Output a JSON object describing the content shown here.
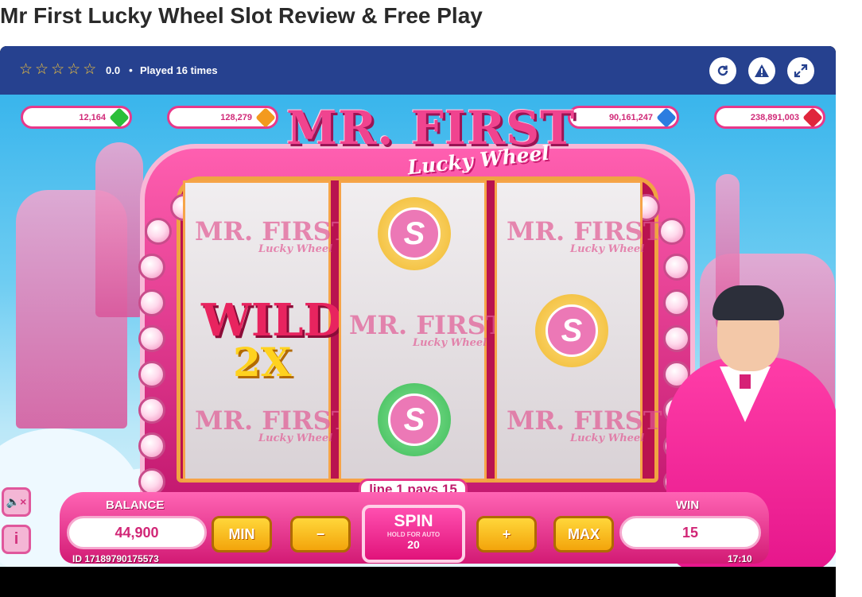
{
  "page": {
    "title": "Mr First Lucky Wheel Slot Review & Free Play"
  },
  "topbar": {
    "stars": [
      "☆",
      "☆",
      "☆",
      "☆",
      "☆"
    ],
    "rating": "0.0",
    "separator": "•",
    "played": "Played 16 times",
    "icons": [
      "reload-icon",
      "report-warning-icon",
      "fullscreen-icon"
    ]
  },
  "jackpots": [
    {
      "value": "12,164",
      "gem": "green-gem-icon",
      "color": "#2bbf3a"
    },
    {
      "value": "128,279",
      "gem": "orange-gem-icon",
      "color": "#f39a1e"
    },
    {
      "value": "90,161,247",
      "gem": "blue-gem-icon",
      "color": "#2b7de0"
    },
    {
      "value": "238,891,003",
      "gem": "red-gem-icon",
      "color": "#e0263c"
    }
  ],
  "logo": {
    "main": "MR. FIRST",
    "sub": "Lucky Wheel"
  },
  "reels": {
    "symbol_logo_main": "MR. FIRST",
    "symbol_logo_sub": "Lucky Wheel",
    "wild": "WILD",
    "multiplier": "2X",
    "coin_letter": "S"
  },
  "paystrip": "line 1 pays 15",
  "console": {
    "balance_label": "BALANCE",
    "balance_value": "44,900",
    "win_label": "WIN",
    "win_value": "15",
    "min_label": "MIN",
    "minus_label": "−",
    "spin_label": "SPIN",
    "spin_hint": "HOLD FOR AUTO",
    "bet_value": "20",
    "plus_label": "+",
    "max_label": "MAX",
    "session_id": "ID 17189790175573",
    "clock": "17:10"
  },
  "side": {
    "mute": "🔈×",
    "info": "i"
  },
  "colors": {
    "accent_pink": "#e8388a",
    "topbar_blue": "#26418f",
    "button_yellow": "#f3a40b"
  }
}
